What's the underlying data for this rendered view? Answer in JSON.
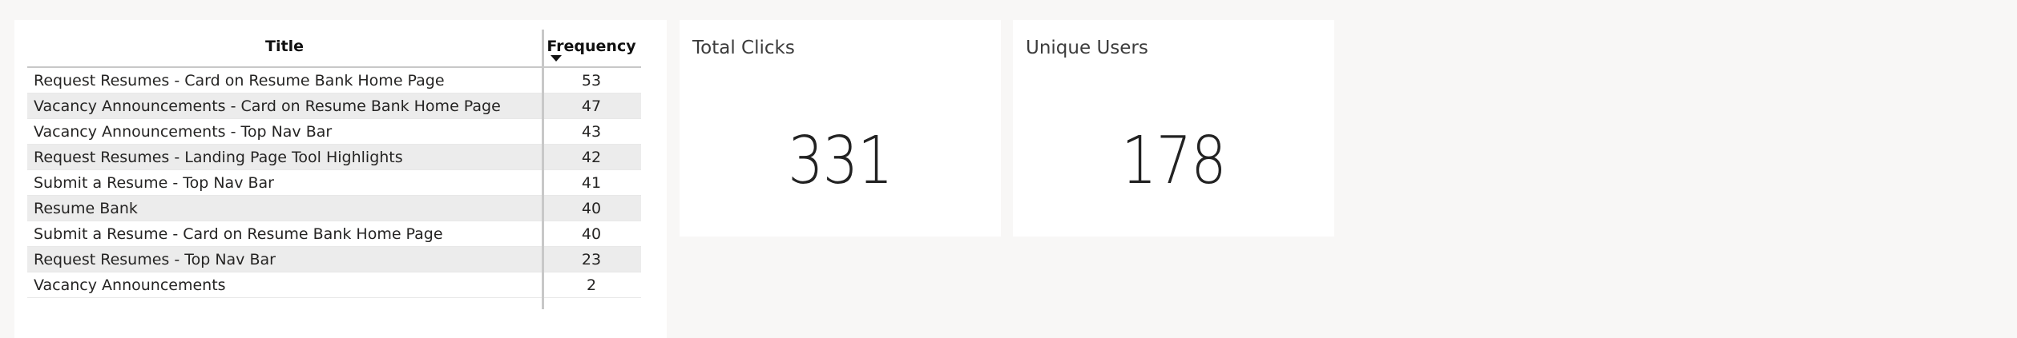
{
  "table": {
    "headers": {
      "title": "Title",
      "frequency": "Frequency"
    },
    "sort": {
      "column": "frequency",
      "direction": "descending"
    },
    "rows": [
      {
        "title": "Request Resumes - Card on Resume Bank Home Page",
        "frequency": "53"
      },
      {
        "title": "Vacancy Announcements - Card on Resume Bank Home Page",
        "frequency": "47"
      },
      {
        "title": "Vacancy Announcements - Top Nav Bar",
        "frequency": "43"
      },
      {
        "title": "Request Resumes - Landing Page Tool Highlights",
        "frequency": "42"
      },
      {
        "title": "Submit a Resume - Top Nav Bar",
        "frequency": "41"
      },
      {
        "title": "Resume Bank",
        "frequency": "40"
      },
      {
        "title": "Submit a Resume - Card on Resume Bank Home Page",
        "frequency": "40"
      },
      {
        "title": "Request Resumes - Top Nav Bar",
        "frequency": "23"
      },
      {
        "title": "Vacancy Announcements",
        "frequency": "2"
      }
    ]
  },
  "cards": {
    "total_clicks": {
      "label": "Total Clicks",
      "value": "331"
    },
    "unique_users": {
      "label": "Unique Users",
      "value": "178"
    }
  },
  "colors": {
    "page_background": "#f8f7f6",
    "visual_background": "#ffffff",
    "alt_row": "#ececec",
    "text": "#252423"
  }
}
